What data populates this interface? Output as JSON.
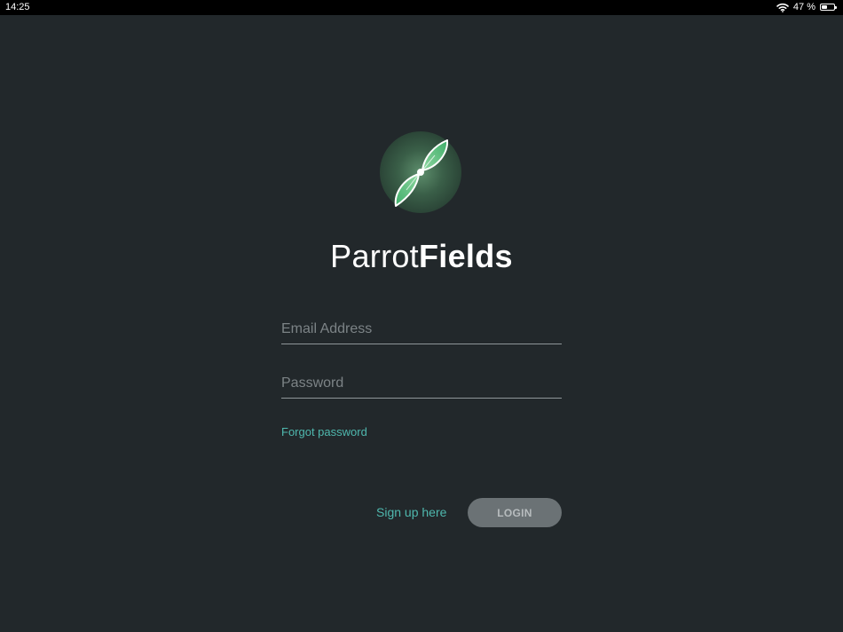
{
  "status_bar": {
    "time": "14:25",
    "battery_text": "47 %",
    "battery_level": 0.47,
    "wifi_icon": "wifi-icon",
    "battery_icon": "battery-icon"
  },
  "brand": {
    "logo_icon": "leaf-logo-icon",
    "name_light": "Parrot",
    "name_bold": "Fields"
  },
  "form": {
    "email_placeholder": "Email Address",
    "email_value": "",
    "password_placeholder": "Password",
    "password_value": "",
    "forgot_password_label": "Forgot password",
    "signup_label": "Sign up here",
    "login_label": "LOGIN"
  },
  "colors": {
    "background": "#22282b",
    "accent": "#4fb8ae",
    "button": "#6b7275",
    "logo_green": "#5cbf80"
  }
}
